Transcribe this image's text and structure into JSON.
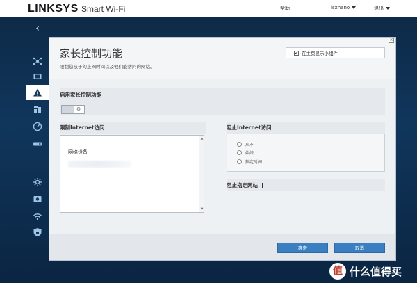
{
  "header": {
    "logo": "LINKSYS",
    "subbrand": "Smart Wi-Fi",
    "help": "帮助",
    "user": "lsxnano",
    "logout": "退出"
  },
  "sidebar": {
    "back_glyph": "‹",
    "icons": [
      "network-map-icon",
      "devices-icon",
      "parental-controls-icon",
      "media-prioritization-icon",
      "speed-test-icon",
      "external-storage-icon",
      "connectivity-icon",
      "troubleshooting-icon",
      "wireless-icon",
      "security-icon"
    ]
  },
  "panel": {
    "title": "家长控制功能",
    "description": "限制您孩子的上网时间以及他们能访问的网站。",
    "widget_label": "在主页显示小组件",
    "widget_checked": true,
    "enable_label": "启用家长控制功能",
    "restrict_label": "限制Internet访问",
    "device_list_label": "网络设备",
    "block_label": "阻止Internet访问",
    "block_options": [
      "从不",
      "始终",
      "指定时间"
    ],
    "block_sites_label": "阻止指定网站",
    "ok_label": "确定",
    "cancel_label": "取消"
  },
  "watermark": {
    "badge": "值",
    "text": "什么值得买"
  },
  "colors": {
    "accent": "#3a7fc1",
    "background": "#10365c",
    "panel": "#eef1f4"
  }
}
